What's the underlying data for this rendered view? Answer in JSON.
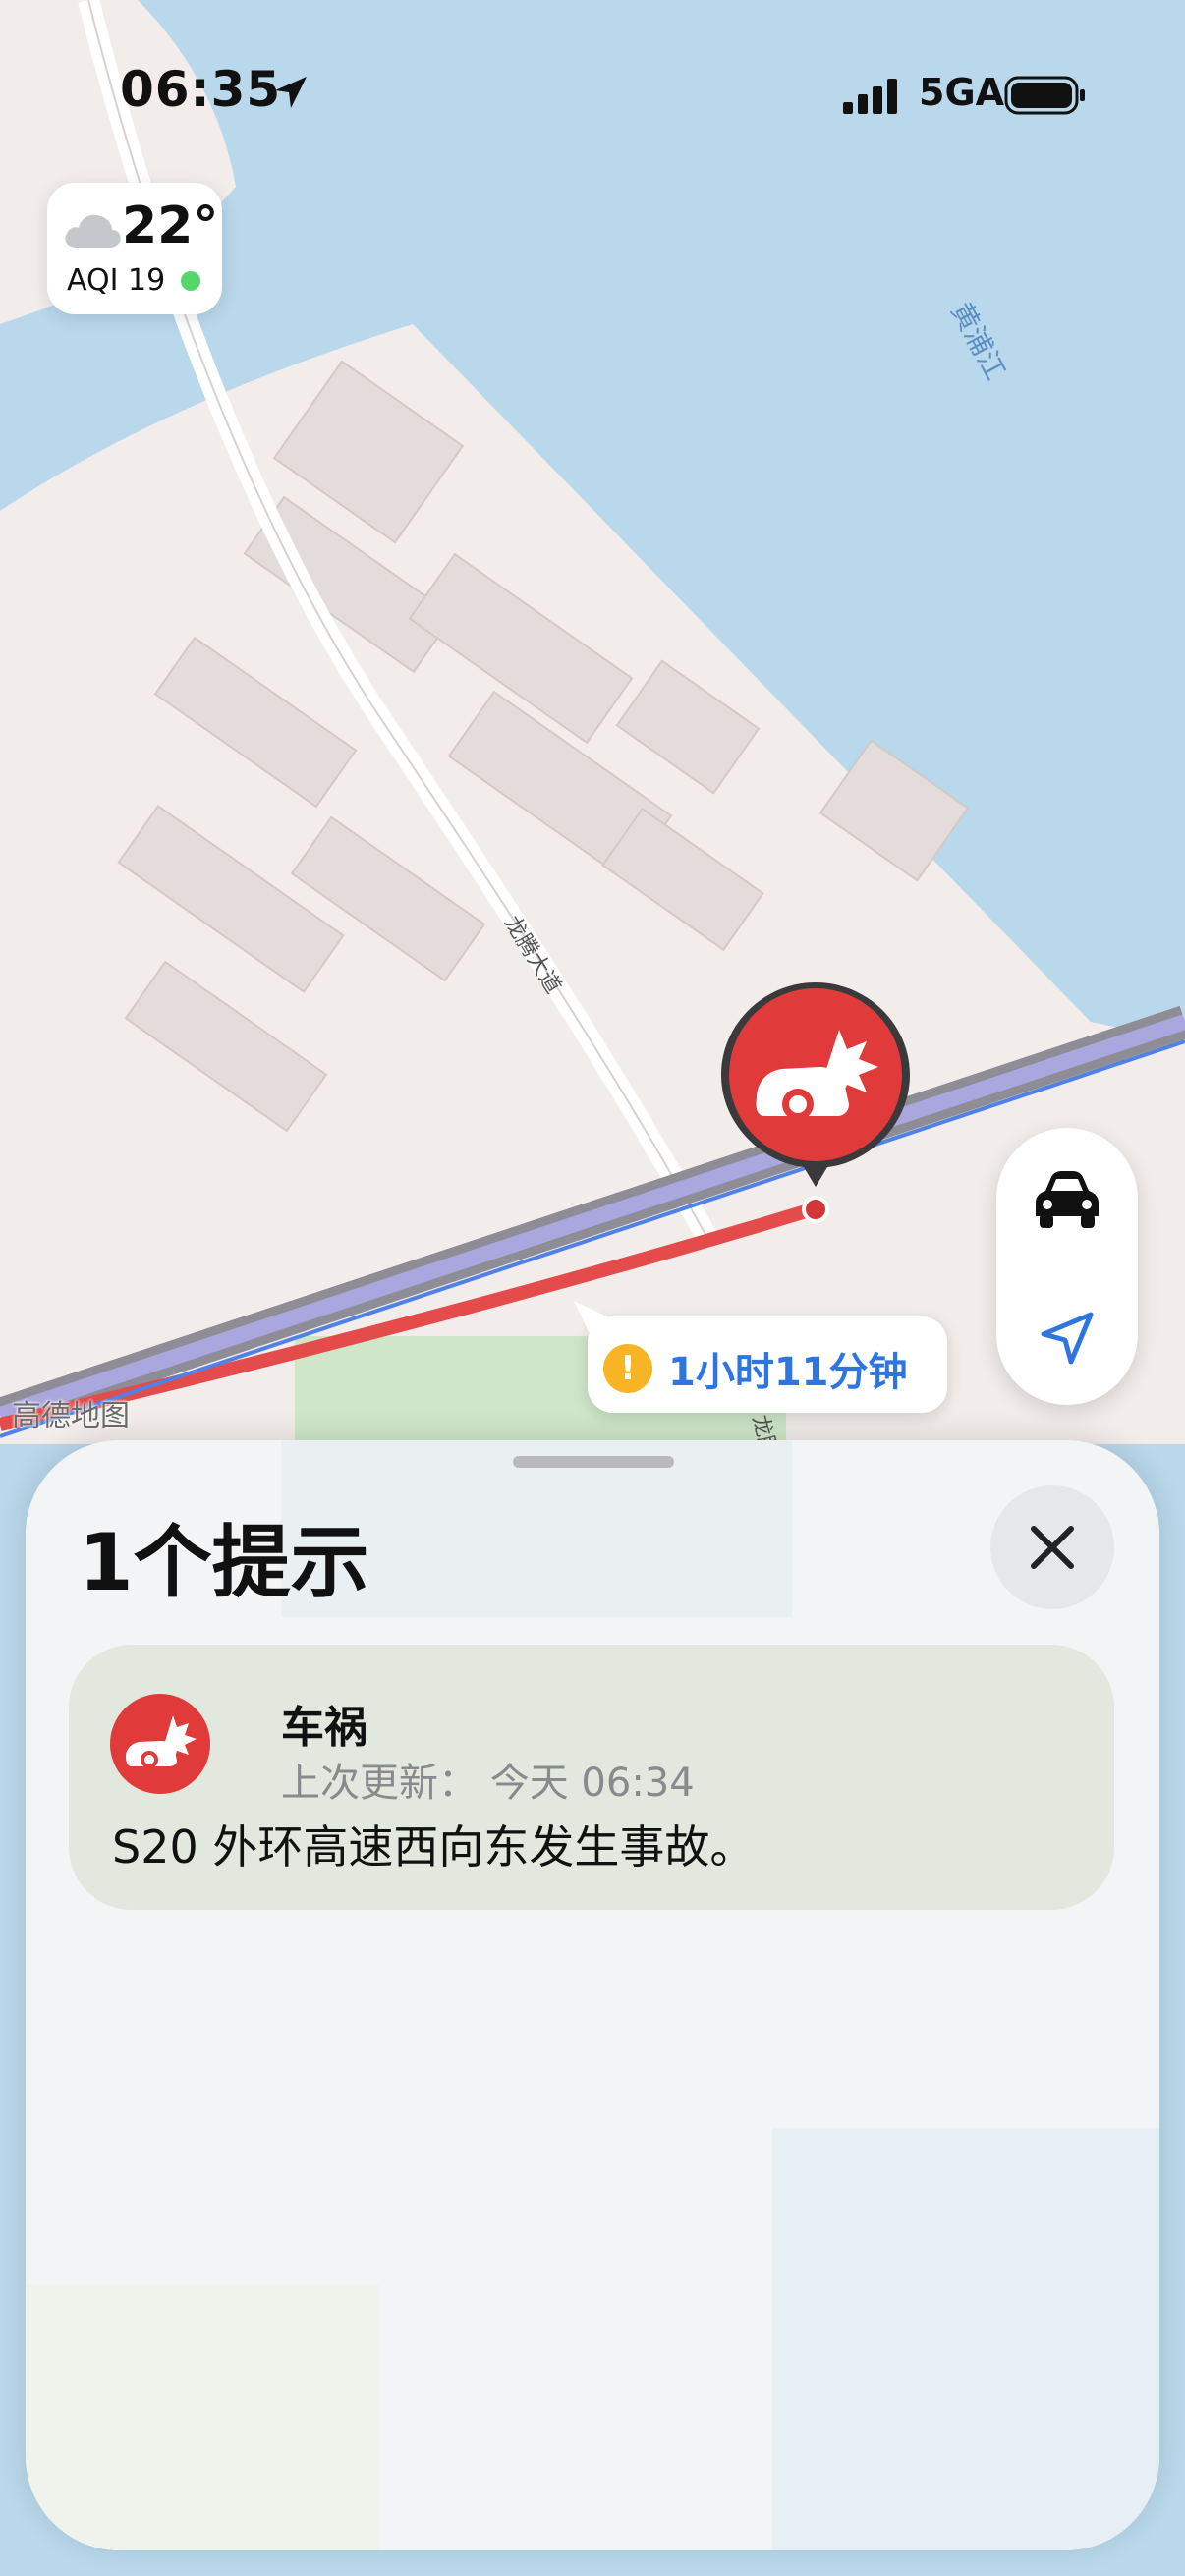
{
  "status_bar": {
    "time": "06:35",
    "network": "5GA"
  },
  "weather": {
    "temperature": "22°",
    "aqi": "AQI 19",
    "icon": "cloud-icon",
    "aqi_status_color": "#53d66a"
  },
  "map": {
    "river_label": "黄浦江",
    "road_label": "龙腾大道",
    "road_label_2": "龙腾大道",
    "attribution": "高德地图",
    "incident_pin_icon": "car-crash-icon",
    "route_color": "#e44b4b"
  },
  "controls": {
    "transport_mode_icon": "car-icon",
    "locate_icon": "location-arrow-icon"
  },
  "eta_bubble": {
    "warning_glyph": "!",
    "text": "1小时11分钟"
  },
  "sheet": {
    "title": "1个提示",
    "close_icon": "close-icon",
    "alerts": [
      {
        "type": "车祸",
        "updated": "上次更新：  今天 06:34",
        "description": "S20 外环高速西向东发生事故。",
        "icon": "car-crash-icon"
      }
    ]
  },
  "colors": {
    "accent_blue": "#2f75e0",
    "incident_red": "#e03a3a",
    "warning_yellow": "#f7b526"
  }
}
